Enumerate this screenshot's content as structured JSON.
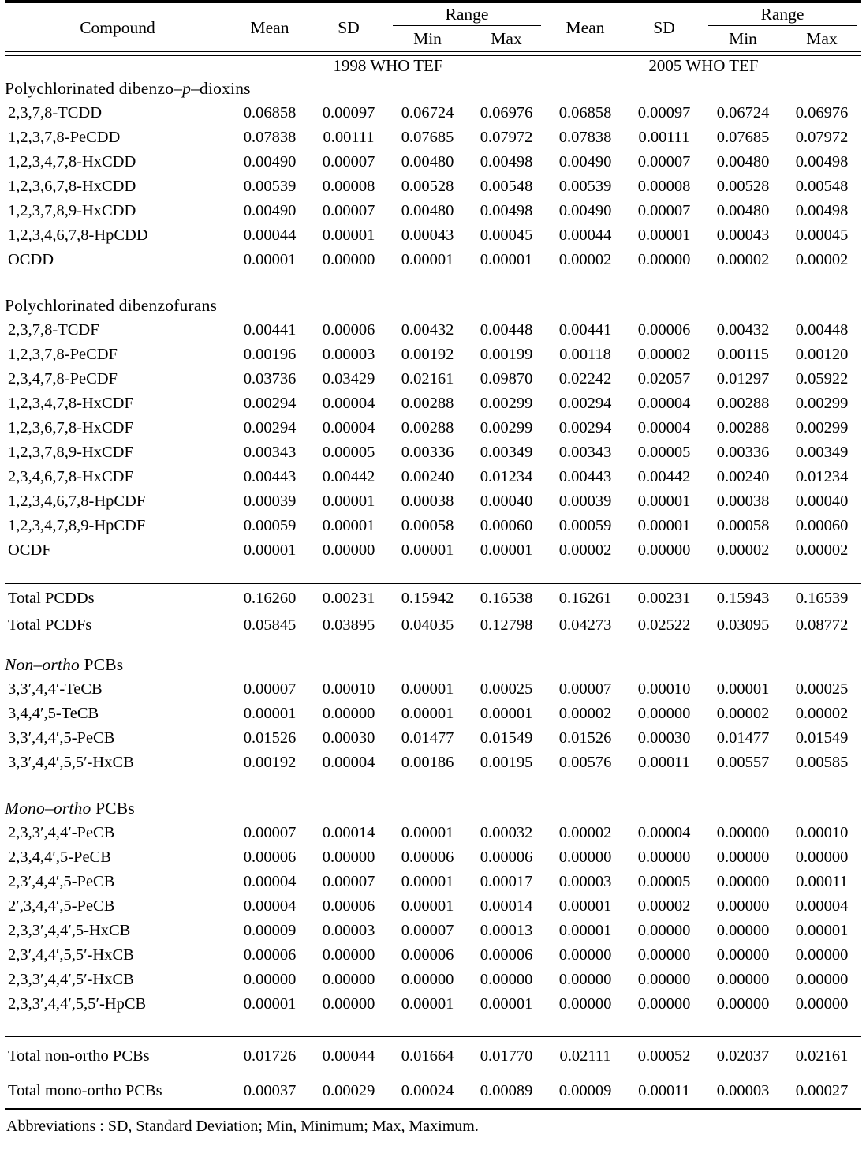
{
  "table": {
    "header": {
      "compound": "Compound",
      "mean": "Mean",
      "sd": "SD",
      "range": "Range",
      "min": "Min",
      "max": "Max"
    },
    "band": {
      "left": "1998 WHO TEF",
      "right": "2005 WHO TEF"
    },
    "groups": [
      {
        "id": "pcdd",
        "label_html": "Polychlorinated dibenzo&#8210;<i>p</i>&#8210;dioxins",
        "label_text": "Polychlorinated dibenzo-p-dioxins",
        "italic": false,
        "rows": [
          {
            "name": "2,3,7,8‐TCDD",
            "v": [
              "0.06858",
              "0.00097",
              "0.06724",
              "0.06976",
              "0.06858",
              "0.00097",
              "0.06724",
              "0.06976"
            ]
          },
          {
            "name": "1,2,3,7,8‐PeCDD",
            "v": [
              "0.07838",
              "0.00111",
              "0.07685",
              "0.07972",
              "0.07838",
              "0.00111",
              "0.07685",
              "0.07972"
            ]
          },
          {
            "name": "1,2,3,4,7,8‐HxCDD",
            "v": [
              "0.00490",
              "0.00007",
              "0.00480",
              "0.00498",
              "0.00490",
              "0.00007",
              "0.00480",
              "0.00498"
            ]
          },
          {
            "name": "1,2,3,6,7,8‐HxCDD",
            "v": [
              "0.00539",
              "0.00008",
              "0.00528",
              "0.00548",
              "0.00539",
              "0.00008",
              "0.00528",
              "0.00548"
            ]
          },
          {
            "name": "1,2,3,7,8,9‐HxCDD",
            "v": [
              "0.00490",
              "0.00007",
              "0.00480",
              "0.00498",
              "0.00490",
              "0.00007",
              "0.00480",
              "0.00498"
            ]
          },
          {
            "name": "1,2,3,4,6,7,8‐HpCDD",
            "v": [
              "0.00044",
              "0.00001",
              "0.00043",
              "0.00045",
              "0.00044",
              "0.00001",
              "0.00043",
              "0.00045"
            ]
          },
          {
            "name": "OCDD",
            "v": [
              "0.00001",
              "0.00000",
              "0.00001",
              "0.00001",
              "0.00002",
              "0.00000",
              "0.00002",
              "0.00002"
            ]
          }
        ]
      },
      {
        "id": "pcdf",
        "label_html": "Polychlorinated dibenzofurans",
        "label_text": "Polychlorinated dibenzofurans",
        "italic": false,
        "rows": [
          {
            "name": "2,3,7,8‐TCDF",
            "v": [
              "0.00441",
              "0.00006",
              "0.00432",
              "0.00448",
              "0.00441",
              "0.00006",
              "0.00432",
              "0.00448"
            ]
          },
          {
            "name": "1,2,3,7,8‐PeCDF",
            "v": [
              "0.00196",
              "0.00003",
              "0.00192",
              "0.00199",
              "0.00118",
              "0.00002",
              "0.00115",
              "0.00120"
            ]
          },
          {
            "name": "2,3,4,7,8‐PeCDF",
            "v": [
              "0.03736",
              "0.03429",
              "0.02161",
              "0.09870",
              "0.02242",
              "0.02057",
              "0.01297",
              "0.05922"
            ]
          },
          {
            "name": "1,2,3,4,7,8‐HxCDF",
            "v": [
              "0.00294",
              "0.00004",
              "0.00288",
              "0.00299",
              "0.00294",
              "0.00004",
              "0.00288",
              "0.00299"
            ]
          },
          {
            "name": "1,2,3,6,7,8‐HxCDF",
            "v": [
              "0.00294",
              "0.00004",
              "0.00288",
              "0.00299",
              "0.00294",
              "0.00004",
              "0.00288",
              "0.00299"
            ]
          },
          {
            "name": "1,2,3,7,8,9‐HxCDF",
            "v": [
              "0.00343",
              "0.00005",
              "0.00336",
              "0.00349",
              "0.00343",
              "0.00005",
              "0.00336",
              "0.00349"
            ]
          },
          {
            "name": "2,3,4,6,7,8‐HxCDF",
            "v": [
              "0.00443",
              "0.00442",
              "0.00240",
              "0.01234",
              "0.00443",
              "0.00442",
              "0.00240",
              "0.01234"
            ]
          },
          {
            "name": "1,2,3,4,6,7,8‐HpCDF",
            "v": [
              "0.00039",
              "0.00001",
              "0.00038",
              "0.00040",
              "0.00039",
              "0.00001",
              "0.00038",
              "0.00040"
            ]
          },
          {
            "name": "1,2,3,4,7,8,9‐HpCDF",
            "v": [
              "0.00059",
              "0.00001",
              "0.00058",
              "0.00060",
              "0.00059",
              "0.00001",
              "0.00058",
              "0.00060"
            ]
          },
          {
            "name": "OCDF",
            "v": [
              "0.00001",
              "0.00000",
              "0.00001",
              "0.00001",
              "0.00002",
              "0.00000",
              "0.00002",
              "0.00002"
            ]
          }
        ]
      }
    ],
    "subtotals_dioxin": [
      {
        "name": "Total PCDDs",
        "v": [
          "0.16260",
          "0.00231",
          "0.15942",
          "0.16538",
          "0.16261",
          "0.00231",
          "0.15943",
          "0.16539"
        ]
      },
      {
        "name": "Total PCDFs",
        "v": [
          "0.05845",
          "0.03895",
          "0.04035",
          "0.12798",
          "0.04273",
          "0.02522",
          "0.03095",
          "0.08772"
        ]
      }
    ],
    "pcb_groups": [
      {
        "id": "non-ortho",
        "label_html": "<i>Non&#8210;ortho</i> PCBs",
        "label_text": "Non-ortho PCBs",
        "rows": [
          {
            "name": "3,3′,4,4′‐TeCB",
            "v": [
              "0.00007",
              "0.00010",
              "0.00001",
              "0.00025",
              "0.00007",
              "0.00010",
              "0.00001",
              "0.00025"
            ]
          },
          {
            "name": "3,4,4′,5‐TeCB",
            "v": [
              "0.00001",
              "0.00000",
              "0.00001",
              "0.00001",
              "0.00002",
              "0.00000",
              "0.00002",
              "0.00002"
            ]
          },
          {
            "name": "3,3′,4,4′,5‐PeCB",
            "v": [
              "0.01526",
              "0.00030",
              "0.01477",
              "0.01549",
              "0.01526",
              "0.00030",
              "0.01477",
              "0.01549"
            ]
          },
          {
            "name": "3,3′,4,4′,5,5′‐HxCB",
            "v": [
              "0.00192",
              "0.00004",
              "0.00186",
              "0.00195",
              "0.00576",
              "0.00011",
              "0.00557",
              "0.00585"
            ]
          }
        ]
      },
      {
        "id": "mono-ortho",
        "label_html": "<i>Mono&#8210;ortho</i> PCBs",
        "label_text": "Mono-ortho PCBs",
        "rows": [
          {
            "name": "2,3,3′,4,4′‐PeCB",
            "v": [
              "0.00007",
              "0.00014",
              "0.00001",
              "0.00032",
              "0.00002",
              "0.00004",
              "0.00000",
              "0.00010"
            ]
          },
          {
            "name": "2,3,4,4′,5‐PeCB",
            "v": [
              "0.00006",
              "0.00000",
              "0.00006",
              "0.00006",
              "0.00000",
              "0.00000",
              "0.00000",
              "0.00000"
            ]
          },
          {
            "name": "2,3′,4,4′,5‐PeCB",
            "v": [
              "0.00004",
              "0.00007",
              "0.00001",
              "0.00017",
              "0.00003",
              "0.00005",
              "0.00000",
              "0.00011"
            ]
          },
          {
            "name": "2′,3,4,4′,5‐PeCB",
            "v": [
              "0.00004",
              "0.00006",
              "0.00001",
              "0.00014",
              "0.00001",
              "0.00002",
              "0.00000",
              "0.00004"
            ]
          },
          {
            "name": "2,3,3′,4,4′,5‐HxCB",
            "v": [
              "0.00009",
              "0.00003",
              "0.00007",
              "0.00013",
              "0.00001",
              "0.00000",
              "0.00000",
              "0.00001"
            ]
          },
          {
            "name": "2,3′,4,4′,5,5′‐HxCB",
            "v": [
              "0.00006",
              "0.00000",
              "0.00006",
              "0.00006",
              "0.00000",
              "0.00000",
              "0.00000",
              "0.00000"
            ]
          },
          {
            "name": "2,3,3′,4,4′,5′‐HxCB",
            "v": [
              "0.00000",
              "0.00000",
              "0.00000",
              "0.00000",
              "0.00000",
              "0.00000",
              "0.00000",
              "0.00000"
            ]
          },
          {
            "name": "2,3,3′,4,4′,5,5′‐HpCB",
            "v": [
              "0.00001",
              "0.00000",
              "0.00001",
              "0.00001",
              "0.00000",
              "0.00000",
              "0.00000",
              "0.00000"
            ]
          }
        ]
      }
    ],
    "pcb_totals": [
      {
        "name": "Total non‐ortho PCBs",
        "v": [
          "0.01726",
          "0.00044",
          "0.01664",
          "0.01770",
          "0.02111",
          "0.00052",
          "0.02037",
          "0.02161"
        ]
      },
      {
        "name": "Total mono‐ortho PCBs",
        "v": [
          "0.00037",
          "0.00029",
          "0.00024",
          "0.00089",
          "0.00009",
          "0.00011",
          "0.00003",
          "0.00027"
        ]
      }
    ],
    "footnote": "Abbreviations : SD, Standard Deviation; Min, Minimum; Max, Maximum."
  }
}
